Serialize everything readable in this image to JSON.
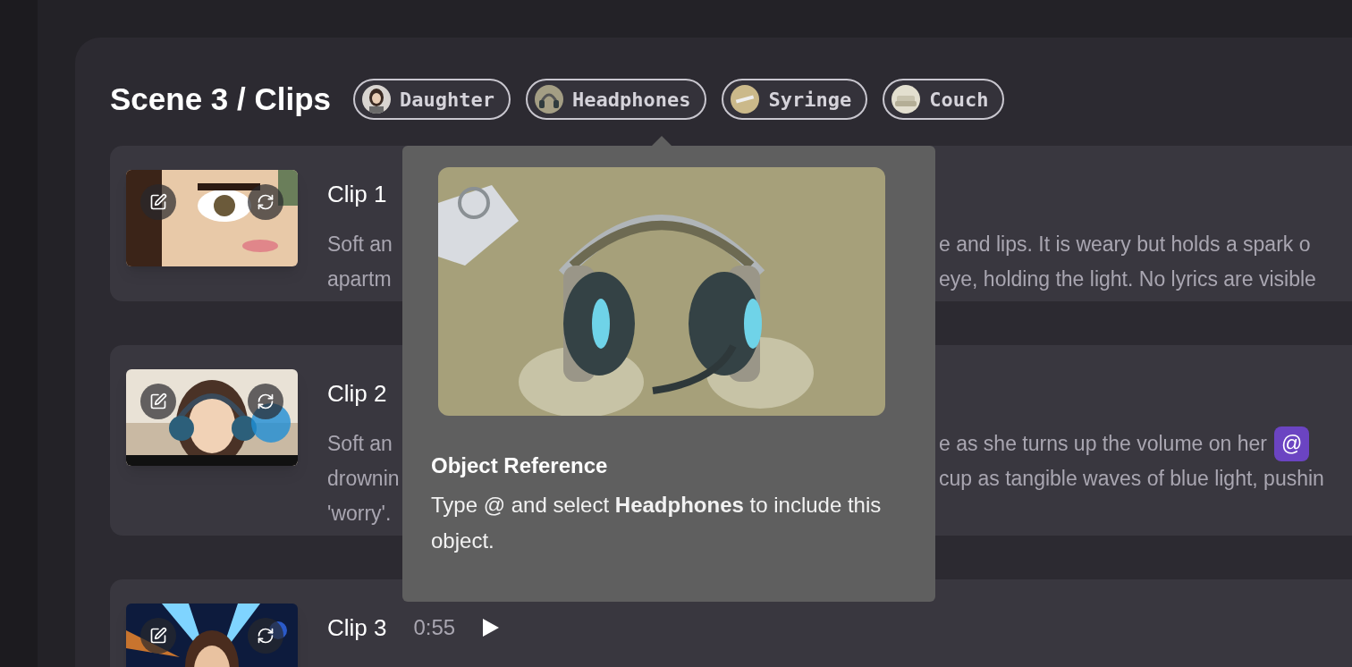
{
  "title": "Scene 3 / Clips",
  "references": [
    {
      "label": "Daughter",
      "kind": "person"
    },
    {
      "label": "Headphones",
      "kind": "headphones"
    },
    {
      "label": "Syringe",
      "kind": "syringe"
    },
    {
      "label": "Couch",
      "kind": "couch"
    }
  ],
  "tooltip": {
    "title": "Object Reference",
    "body": "Type @ and select **Headphones** to include this object."
  },
  "clips": [
    {
      "title": "Clip 1",
      "lines": [
        {
          "left": "Soft an",
          "right": "e and lips. It is weary but holds a spark o"
        },
        {
          "left": "apartm",
          "right": "eye, holding the light. No lyrics are visible"
        }
      ]
    },
    {
      "title": "Clip 2",
      "lines": [
        {
          "left": "Soft an",
          "right": "e as she turns up the volume on her",
          "mention": "@"
        },
        {
          "left": "drownin",
          "right": "cup as tangible waves of blue light, pushin"
        },
        {
          "left": "'worry'."
        }
      ]
    },
    {
      "title": "Clip 3",
      "duration": "0:55"
    }
  ]
}
